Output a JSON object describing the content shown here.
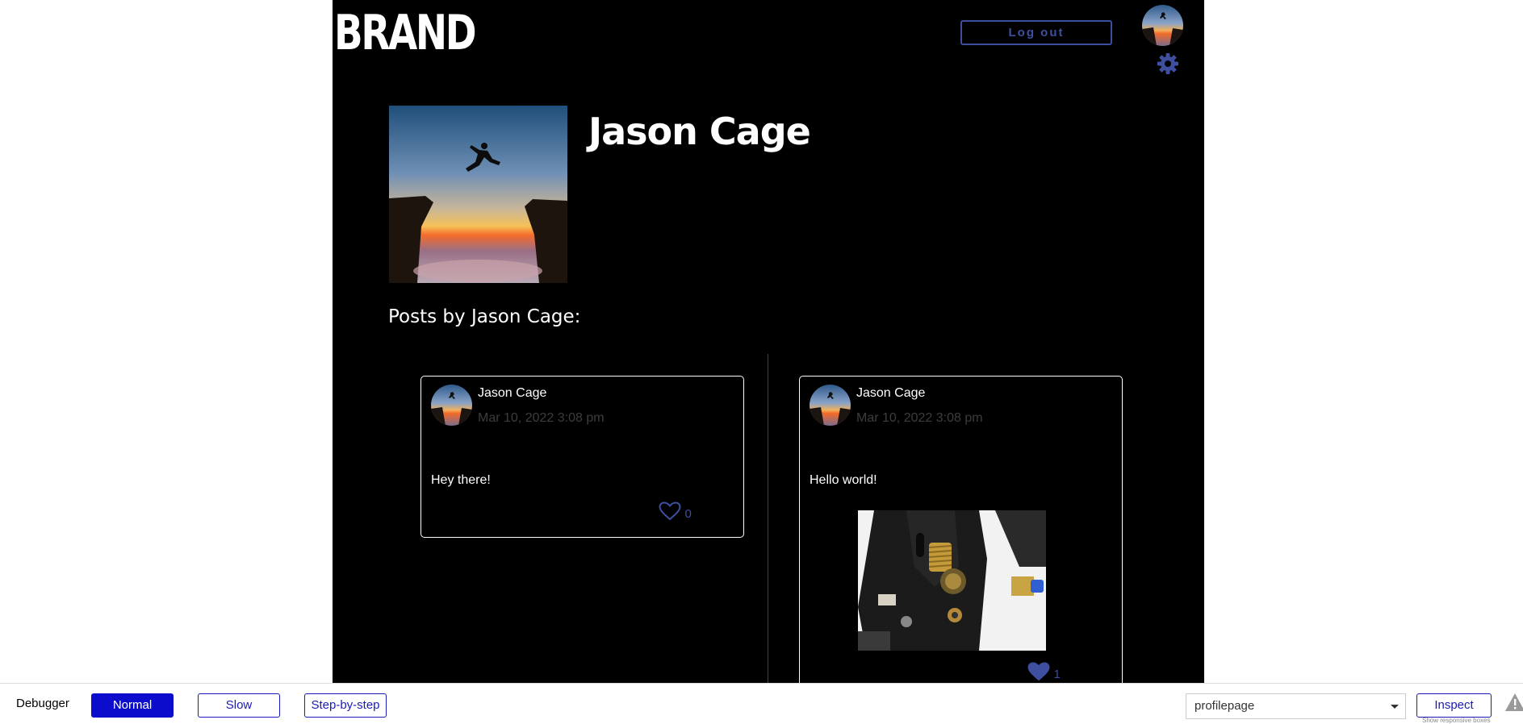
{
  "header": {
    "brand": "BRAND",
    "logout_label": "Log out"
  },
  "profile": {
    "name": "Jason Cage",
    "posts_heading": "Posts by Jason Cage:"
  },
  "posts": [
    {
      "author": "Jason Cage",
      "timestamp": "Mar 10, 2022 3:08 pm",
      "text": "Hey there!",
      "likes": "0",
      "has_image": false
    },
    {
      "author": "Jason Cage",
      "timestamp": "Mar 10, 2022 3:08 pm",
      "text": "Hello world!",
      "likes": "1",
      "has_image": true
    }
  ],
  "debugger": {
    "label": "Debugger",
    "modes": [
      "Normal",
      "Slow",
      "Step-by-step"
    ],
    "active_mode": "Normal",
    "page_select": "profilepage",
    "inspect_label": "Inspect",
    "inspect_sub": "Show responsive boxes"
  },
  "colors": {
    "accent": "#3e4f9f",
    "background": "#000000",
    "debug_primary": "#0c0ccd"
  },
  "icons": {
    "settings": "gear-icon",
    "like": "heart-icon",
    "warning": "warning-icon"
  }
}
